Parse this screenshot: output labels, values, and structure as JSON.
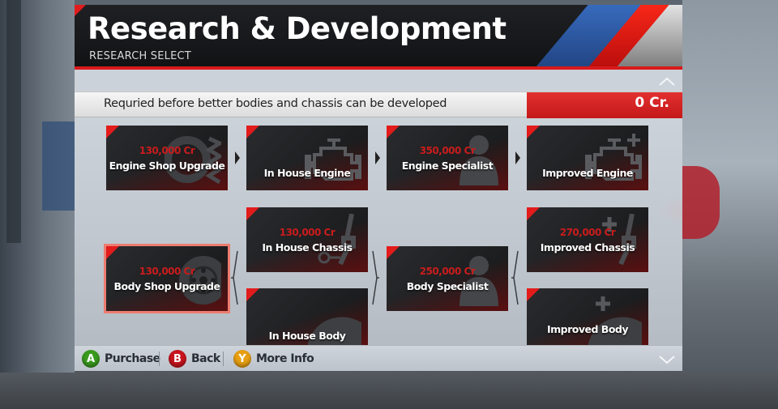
{
  "header": {
    "title": "Research & Development",
    "subtitle": "RESEARCH SELECT"
  },
  "info": {
    "description": "Requried before better bodies and chassis can be developed",
    "credits": "0 Cr."
  },
  "colors": {
    "accent_red": "#d81a1a",
    "cost_red": "#c91c1c",
    "selected_outline": "#ec7c70",
    "stripe_blue": "#3a6fc4"
  },
  "tiles": {
    "engine_shop_upgrade": {
      "name": "Engine Shop Upgrade",
      "cost": "130,000 Cr",
      "icon": "brake-disc-spring-icon"
    },
    "in_house_engine": {
      "name": "In House Engine",
      "cost": "",
      "icon": "engine-icon"
    },
    "engine_specialist": {
      "name": "Engine Specialist",
      "cost": "350,000 Cr",
      "icon": "person-silhouette-icon"
    },
    "improved_engine": {
      "name": "Improved Engine",
      "cost": "",
      "icon": "engine-plus-icon"
    },
    "body_shop_upgrade": {
      "name": "Body Shop Upgrade",
      "cost": "130,000 Cr",
      "icon": "wheel-hub-icon",
      "selected": true
    },
    "in_house_chassis": {
      "name": "In House Chassis",
      "cost": "130,000 Cr",
      "icon": "suspension-icon"
    },
    "in_house_body": {
      "name": "In House Body",
      "cost": "",
      "icon": "car-body-icon"
    },
    "body_specialist": {
      "name": "Body Specialist",
      "cost": "250,000 Cr",
      "icon": "person-silhouette-icon"
    },
    "improved_chassis": {
      "name": "Improved Chassis",
      "cost": "270,000 Cr",
      "icon": "suspension-plus-icon"
    },
    "improved_body": {
      "name": "Improved Body",
      "cost": "",
      "icon": "car-body-plus-icon"
    }
  },
  "footer": {
    "buttons": [
      {
        "key": "A",
        "label": "Purchase",
        "color": "#3a9a1e"
      },
      {
        "key": "B",
        "label": "Back",
        "color": "#c8141e"
      },
      {
        "key": "Y",
        "label": "More Info",
        "color": "#e8a012"
      }
    ]
  },
  "scroll": {
    "up_icon": "chevron-up-icon",
    "down_icon": "chevron-down-icon"
  }
}
